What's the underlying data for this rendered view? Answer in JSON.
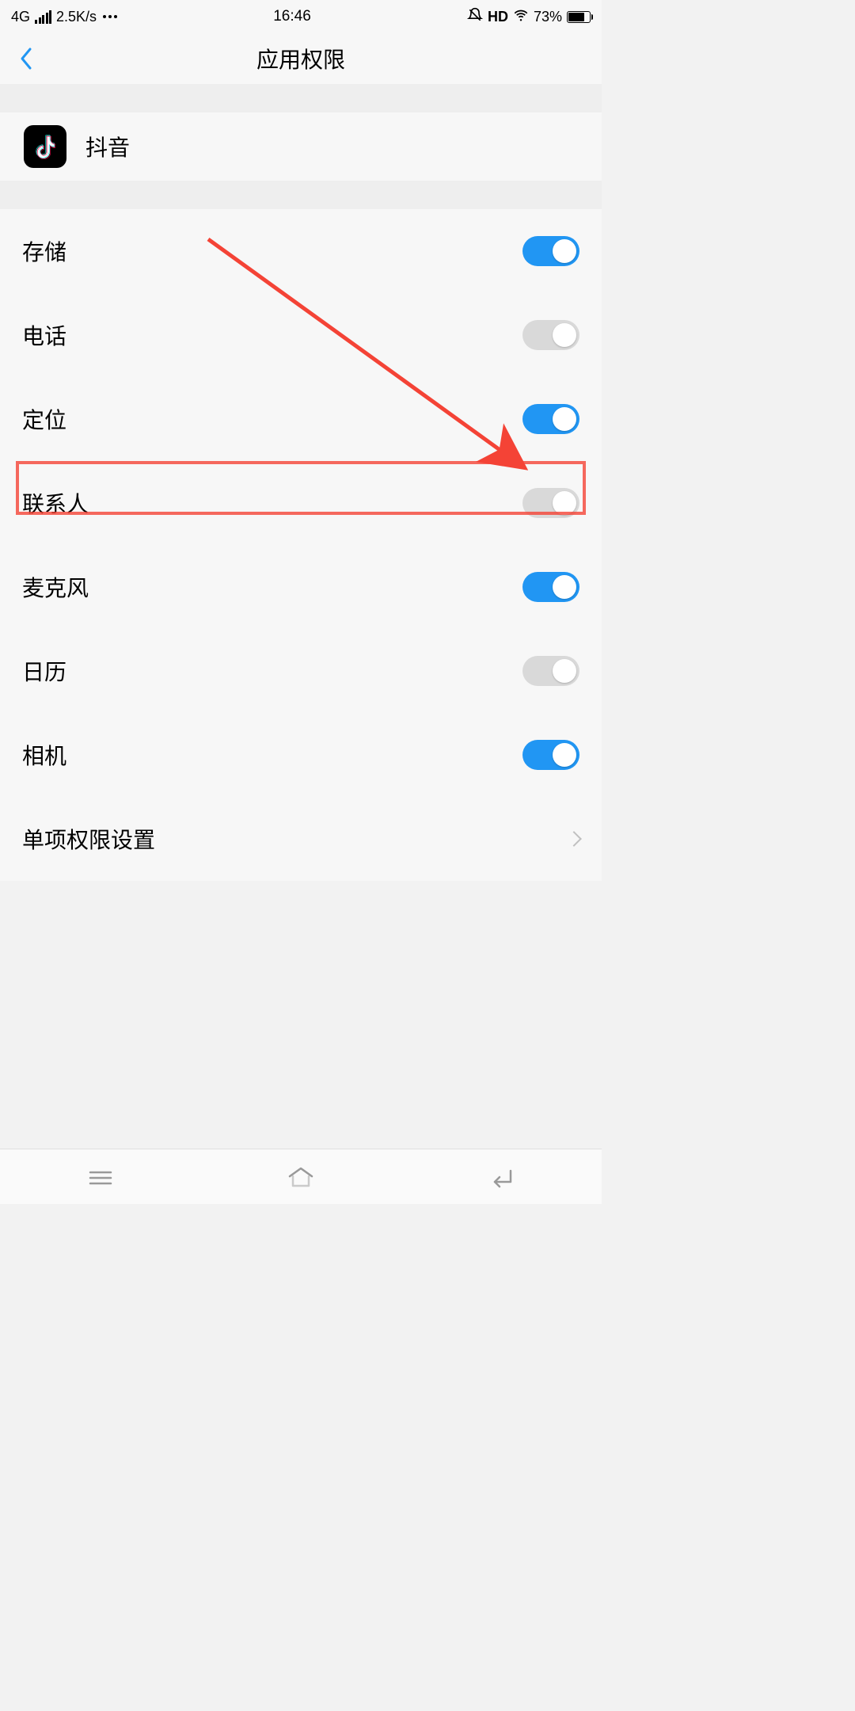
{
  "status": {
    "network": "4G",
    "speed": "2.5K/s",
    "time": "16:46",
    "hd": "HD",
    "battery_pct": "73%"
  },
  "header": {
    "title": "应用权限"
  },
  "app": {
    "name": "抖音"
  },
  "permissions": [
    {
      "label": "存储",
      "on": true
    },
    {
      "label": "电话",
      "on": false
    },
    {
      "label": "定位",
      "on": true
    },
    {
      "label": "联系人",
      "on": false
    },
    {
      "label": "麦克风",
      "on": true
    },
    {
      "label": "日历",
      "on": false
    },
    {
      "label": "相机",
      "on": true
    }
  ],
  "link": {
    "label": "单项权限设置"
  },
  "annotation": {
    "highlight_row_index": 4
  }
}
